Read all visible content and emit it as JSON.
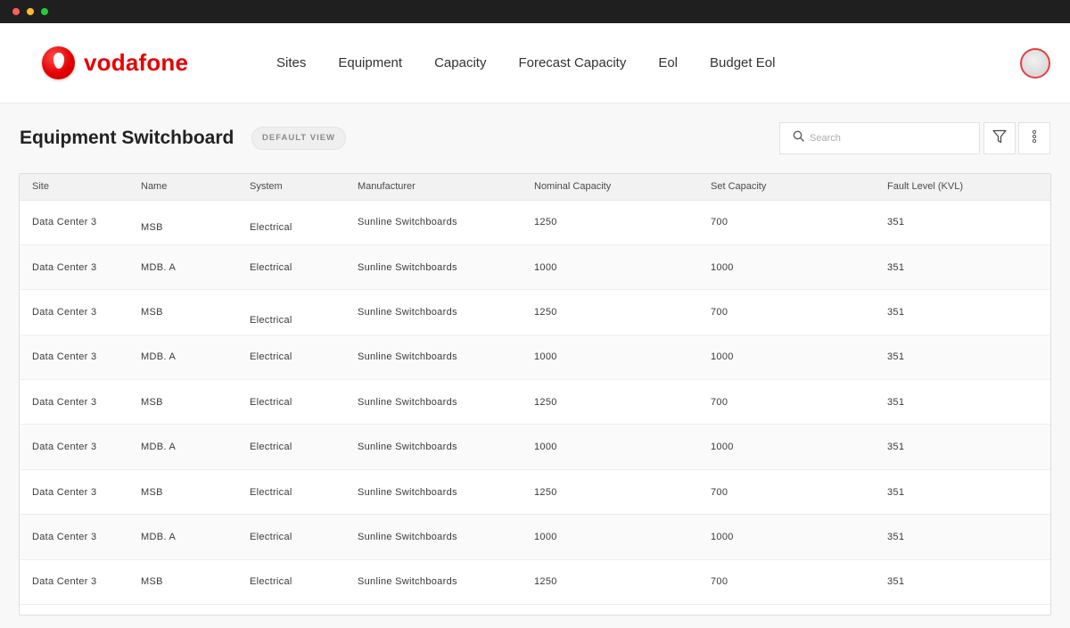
{
  "window": {
    "dots": [
      "#ff5f57",
      "#febc2e",
      "#28c840"
    ]
  },
  "brand": {
    "name": "vodafone",
    "color": "#e60000"
  },
  "nav": {
    "items": [
      {
        "label": "Sites"
      },
      {
        "label": "Equipment"
      },
      {
        "label": "Capacity"
      },
      {
        "label": "Forecast Capacity"
      },
      {
        "label": "Eol"
      },
      {
        "label": "Budget Eol"
      }
    ]
  },
  "page": {
    "title": "Equipment Switchboard",
    "view_badge": "DEFAULT VIEW"
  },
  "search": {
    "placeholder": "Search",
    "value": ""
  },
  "icons": {
    "search": "search-icon",
    "filter": "filter-icon",
    "more": "more-vertical-icon",
    "avatar": "user-avatar"
  },
  "table": {
    "columns": [
      "Site",
      "Name",
      "System",
      "Manufacturer",
      "Nominal Capacity",
      "Set Capacity",
      "Fault Level (KVL)"
    ],
    "rows": [
      [
        "Data Center 3",
        "MSB",
        "Electrical",
        "Sunline Switchboards",
        "1250",
        "700",
        "351"
      ],
      [
        "Data Center 3",
        "MDB. A",
        "Electrical",
        "Sunline Switchboards",
        "1000",
        "1000",
        "351"
      ],
      [
        "Data Center 3",
        "MSB",
        "Electrical",
        "Sunline Switchboards",
        "1250",
        "700",
        "351"
      ],
      [
        "Data Center 3",
        "MDB. A",
        "Electrical",
        "Sunline Switchboards",
        "1000",
        "1000",
        "351"
      ],
      [
        "Data Center 3",
        "MSB",
        "Electrical",
        "Sunline Switchboards",
        "1250",
        "700",
        "351"
      ],
      [
        "Data Center 3",
        "MDB. A",
        "Electrical",
        "Sunline Switchboards",
        "1000",
        "1000",
        "351"
      ],
      [
        "Data Center 3",
        "MSB",
        "Electrical",
        "Sunline Switchboards",
        "1250",
        "700",
        "351"
      ],
      [
        "Data Center 3",
        "MDB. A",
        "Electrical",
        "Sunline Switchboards",
        "1000",
        "1000",
        "351"
      ],
      [
        "Data Center 3",
        "MSB",
        "Electrical",
        "Sunline Switchboards",
        "1250",
        "700",
        "351"
      ]
    ]
  }
}
